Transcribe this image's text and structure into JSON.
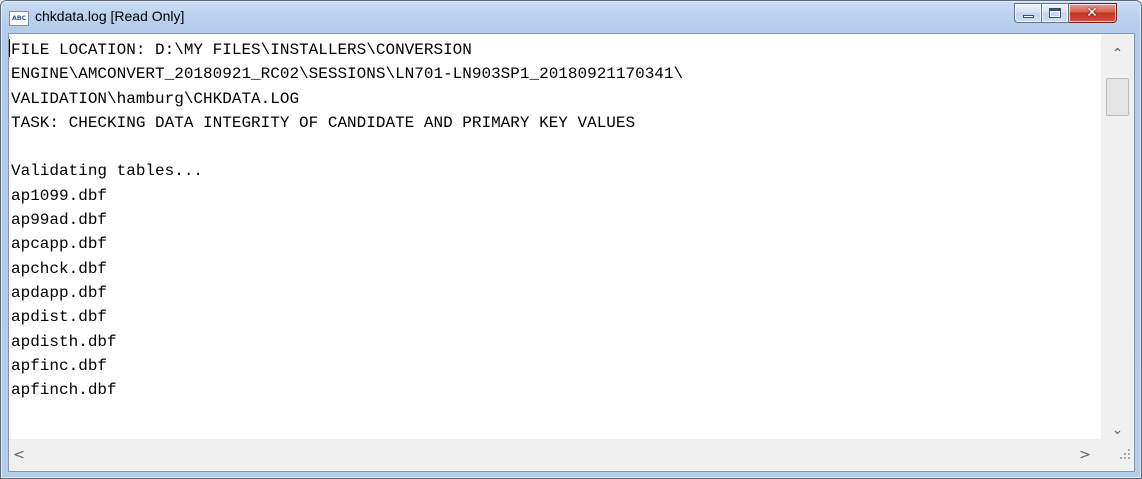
{
  "window": {
    "app_icon_text": "ABC",
    "title": "chkdata.log [Read Only]",
    "controls": {
      "minimize_icon": "minimize-icon",
      "maximize_icon": "maximize-icon",
      "close_icon": "close-icon",
      "close_glyph": "✕",
      "close_color": "#c2321d"
    }
  },
  "editor": {
    "lines": [
      "FILE LOCATION: D:\\MY FILES\\INSTALLERS\\CONVERSION",
      "ENGINE\\AMCONVERT_20180921_RC02\\SESSIONS\\LN701-LN903SP1_20180921170341\\",
      "VALIDATION\\hamburg\\CHKDATA.LOG",
      "TASK: CHECKING DATA INTEGRITY OF CANDIDATE AND PRIMARY KEY VALUES",
      "",
      "Validating tables...",
      "ap1099.dbf",
      "ap99ad.dbf",
      "apcapp.dbf",
      "apchck.dbf",
      "apdapp.dbf",
      "apdist.dbf",
      "apdisth.dbf",
      "apfinc.dbf",
      "apfinch.dbf"
    ]
  },
  "scrollbars": {
    "up_glyph": "⌃",
    "down_glyph": "⌄",
    "left_glyph": "<",
    "right_glyph": ">"
  }
}
